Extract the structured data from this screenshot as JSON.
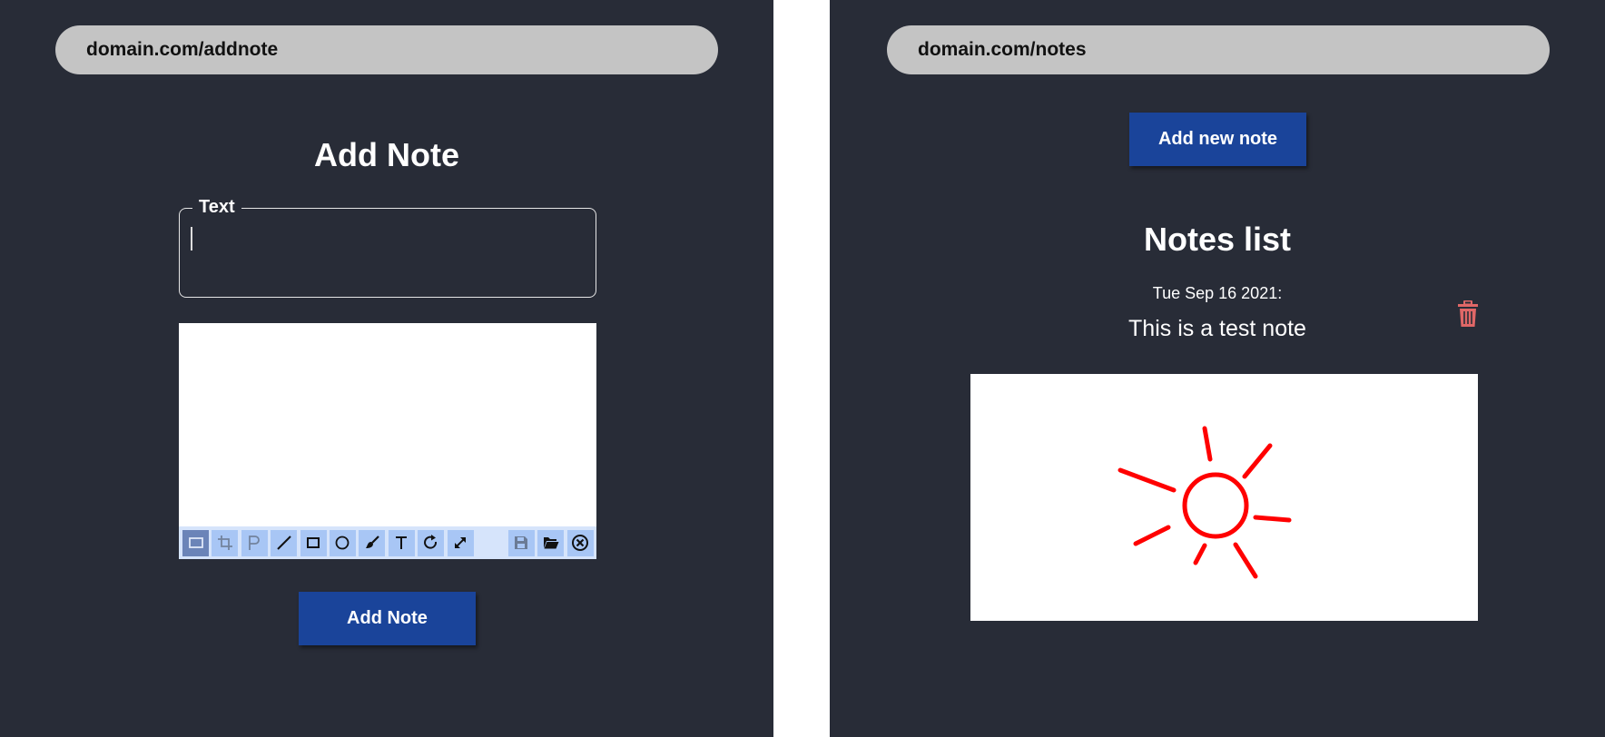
{
  "left": {
    "url": "domain.com/addnote",
    "heading": "Add Note",
    "text_field": {
      "label": "Text",
      "value": ""
    },
    "toolbar": {
      "tools": [
        {
          "name": "select-tool-icon",
          "active": true
        },
        {
          "name": "crop-icon",
          "disabled": true
        },
        {
          "name": "pen-icon",
          "disabled": true
        },
        {
          "name": "line-icon"
        },
        {
          "name": "rectangle-icon"
        },
        {
          "name": "ellipse-icon"
        },
        {
          "name": "brush-icon"
        },
        {
          "name": "text-tool-icon"
        },
        {
          "name": "redo-icon"
        },
        {
          "name": "resize-icon"
        }
      ],
      "right_tools": [
        {
          "name": "save-icon",
          "disabled": true
        },
        {
          "name": "open-folder-icon"
        },
        {
          "name": "close-circle-icon"
        }
      ]
    },
    "submit_label": "Add Note"
  },
  "right": {
    "url": "domain.com/notes",
    "add_button_label": "Add new note",
    "heading": "Notes list",
    "notes": [
      {
        "date": "Tue Sep 16 2021:",
        "text": "This is a test note",
        "drawing": "sun-sketch",
        "drawing_color": "#ff0000"
      }
    ]
  },
  "colors": {
    "panel_bg": "#282c37",
    "urlbar_bg": "#c4c4c4",
    "button_bg": "#1a449a",
    "trash": "#e06767",
    "toolbar_bg": "#d6e4fb",
    "tool_bg": "#a8c6f5"
  }
}
